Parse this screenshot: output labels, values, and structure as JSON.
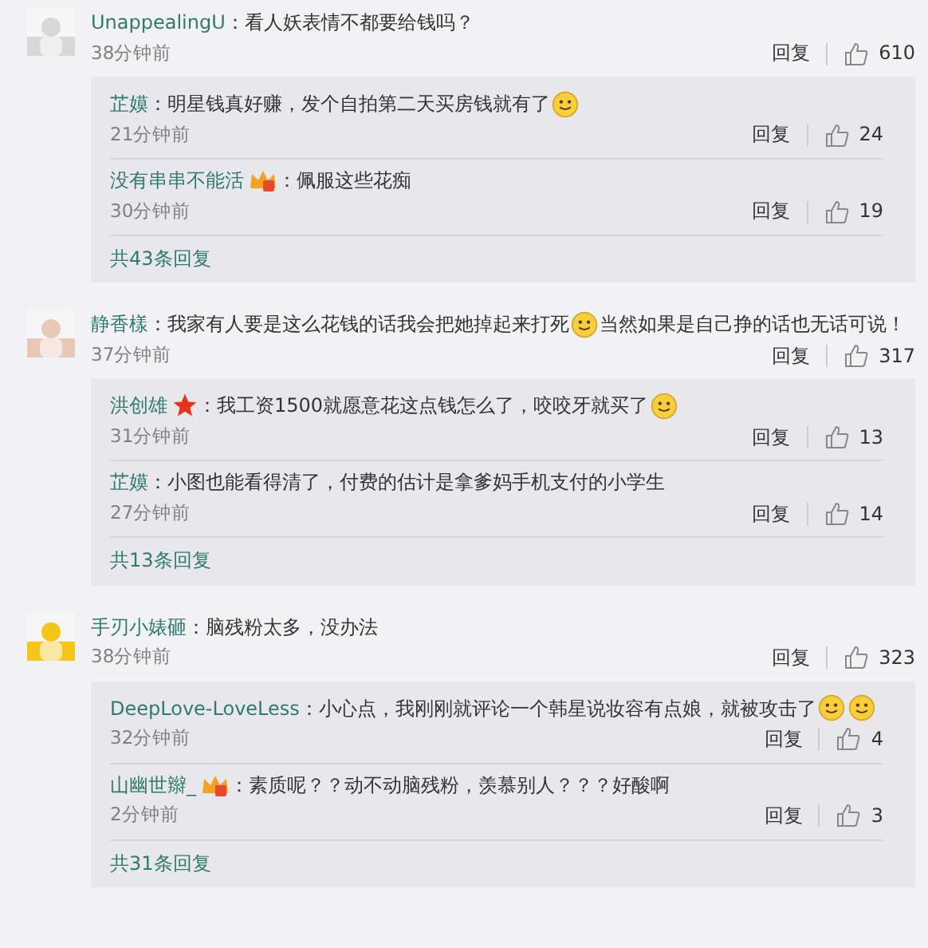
{
  "comments": [
    {
      "avatar": {
        "kind": "picture"
      },
      "name": "UnappealingU",
      "separator": "：",
      "content": [
        {
          "kind": "text",
          "text": "看人妖表情不都要给钱吗？"
        }
      ],
      "time": "38分钟前",
      "reply_label": "回复",
      "likes": "610",
      "replies": [
        {
          "name": "芷嫫",
          "separator": "：",
          "content": [
            {
              "kind": "text",
              "text": "明星钱真好赚，发个自拍第二天买房钱就有了"
            },
            {
              "kind": "emoji"
            }
          ],
          "time": "21分钟前",
          "reply_label": "回复",
          "likes": "24"
        },
        {
          "name": "没有串串不能活",
          "badge": {
            "kind": "vip"
          },
          "separator": "：",
          "content": [
            {
              "kind": "text",
              "text": "佩服这些花痴"
            }
          ],
          "time": "30分钟前",
          "reply_label": "回复",
          "likes": "19"
        }
      ],
      "more": "共43条回复"
    },
    {
      "avatar": {
        "kind": "picture"
      },
      "name": "静香樣",
      "separator": "：",
      "content": [
        {
          "kind": "text",
          "text": "我家有人要是这么花钱的话我会把她掉起来打死"
        },
        {
          "kind": "emoji"
        },
        {
          "kind": "text",
          "text": "当然如果是自己挣的话也无话可说！"
        }
      ],
      "time": "37分钟前",
      "reply_label": "回复",
      "likes": "317",
      "replies": [
        {
          "name": "洪创雄",
          "badge": {
            "kind": "star"
          },
          "separator": "：",
          "content": [
            {
              "kind": "text",
              "text": "我工资1500就愿意花这点钱怎么了，咬咬牙就买了"
            },
            {
              "kind": "emoji"
            }
          ],
          "time": "31分钟前",
          "reply_label": "回复",
          "likes": "13"
        },
        {
          "name": "芷嫫",
          "separator": "：",
          "content": [
            {
              "kind": "text",
              "text": "小图也能看得清了，付费的估计是拿爹妈手机支付的小学生"
            }
          ],
          "time": "27分钟前",
          "reply_label": "回复",
          "likes": "14"
        }
      ],
      "more": "共13条回复"
    },
    {
      "avatar": {
        "kind": "picture"
      },
      "name": "手刃小婊砸",
      "separator": "：",
      "content": [
        {
          "kind": "text",
          "text": "脑残粉太多，没办法"
        }
      ],
      "time": "38分钟前",
      "reply_label": "回复",
      "likes": "323",
      "replies": [
        {
          "name": "DeepLove-LoveLess",
          "separator": "：",
          "content": [
            {
              "kind": "text",
              "text": "小心点，我刚刚就评论一个韩星说妆容有点娘，就被攻击了"
            },
            {
              "kind": "emoji"
            },
            {
              "kind": "emoji"
            }
          ],
          "time": "32分钟前",
          "reply_label": "回复",
          "likes": "4"
        },
        {
          "name": "山幽世辮_",
          "badge": {
            "kind": "vip"
          },
          "separator": "：",
          "content": [
            {
              "kind": "text",
              "text": "素质呢？？动不动脑残粉，羡慕别人？？？好酸啊"
            }
          ],
          "time": "2分钟前",
          "reply_label": "回复",
          "likes": "3"
        }
      ],
      "more": "共31条回复"
    }
  ]
}
